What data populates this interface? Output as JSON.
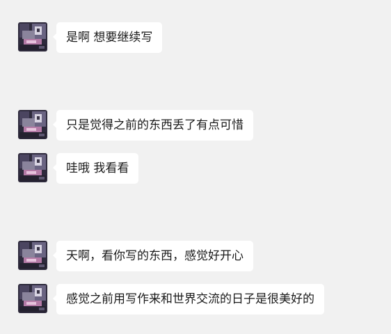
{
  "colors": {
    "background": "#f1f1f1",
    "bubble": "#ffffff",
    "text": "#1a1a1a"
  },
  "messages": [
    {
      "sender": "other",
      "text": "是啊 想要继续写"
    },
    {
      "sender": "other",
      "text": "只是觉得之前的东西丢了有点可惜"
    },
    {
      "sender": "other",
      "text": "哇哦 我看看"
    },
    {
      "sender": "other",
      "text": "天啊，看你写的东西，感觉好开心"
    },
    {
      "sender": "other",
      "text": "感觉之前用写作来和世界交流的日子是很美好的"
    }
  ]
}
